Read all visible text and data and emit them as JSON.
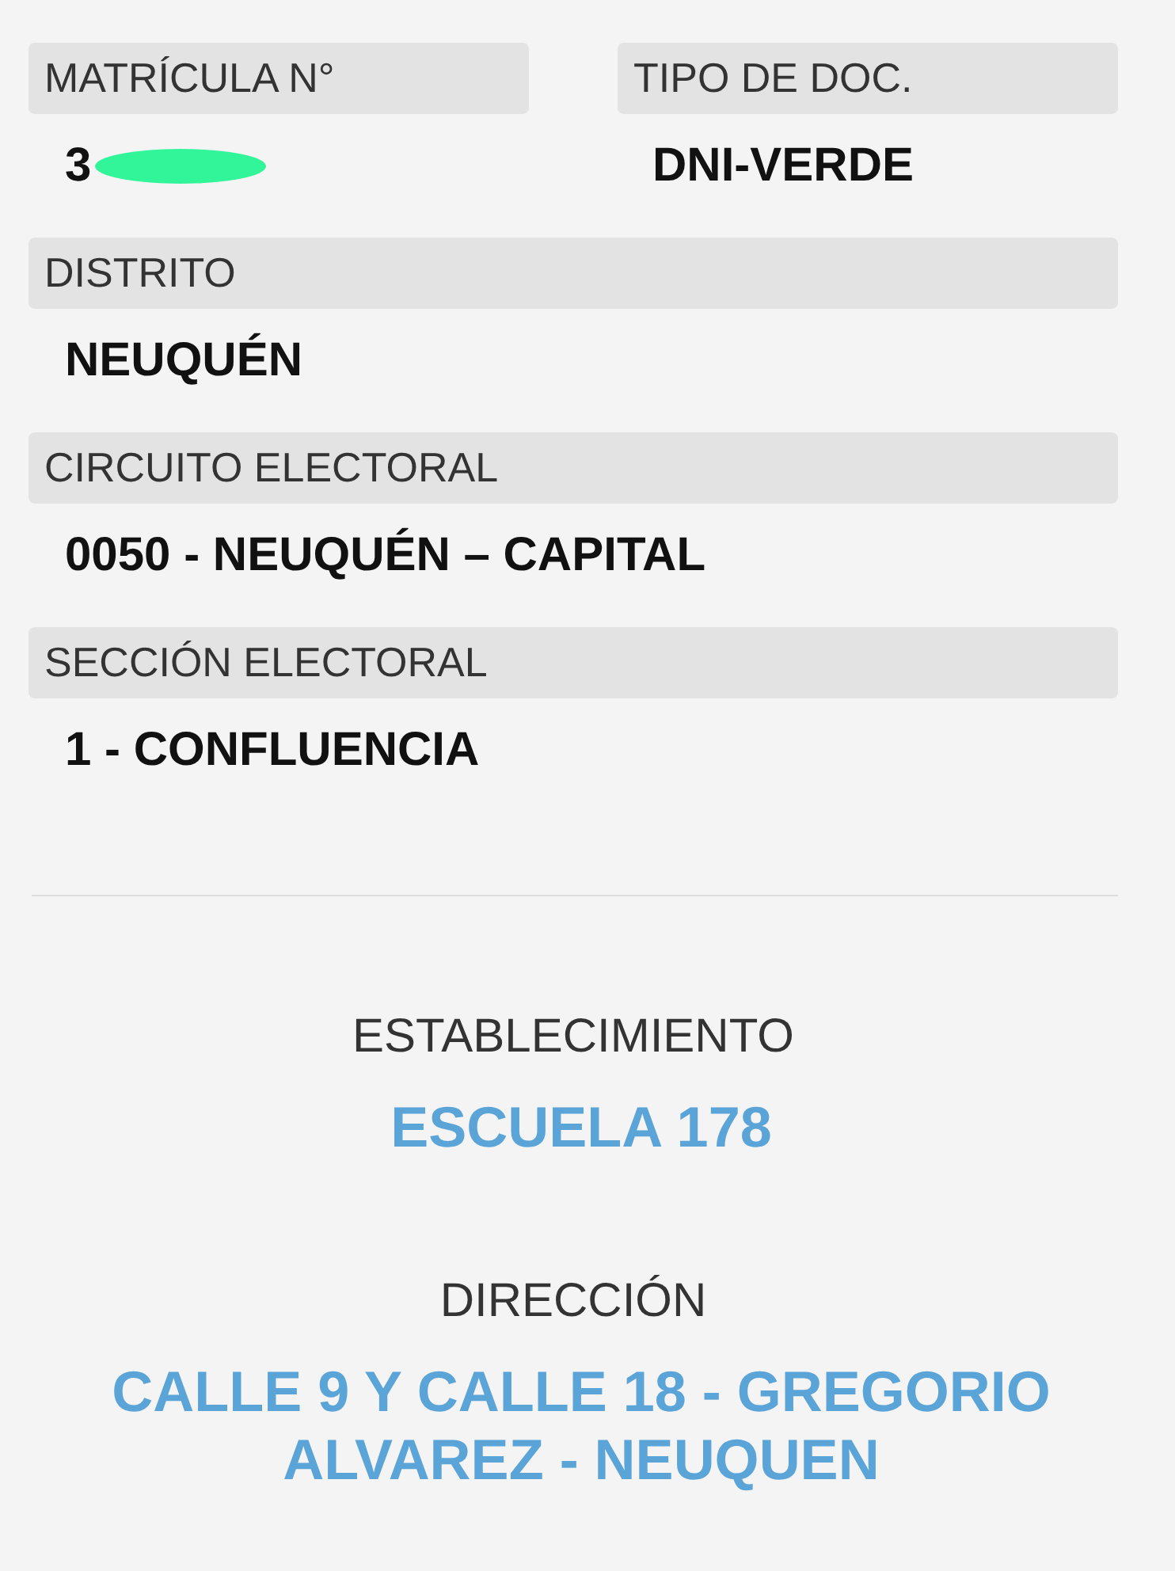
{
  "top_fields": [
    {
      "label": "MATRÍCULA N°",
      "value": "3",
      "redacted": true
    },
    {
      "label": "TIPO DE DOC.",
      "value": "DNI-VERDE"
    }
  ],
  "fields": [
    {
      "label": "DISTRITO",
      "value": "NEUQUÉN"
    },
    {
      "label": "CIRCUITO ELECTORAL",
      "value": "0050 - NEUQUÉN – CAPITAL"
    },
    {
      "label": "SECCIÓN ELECTORAL",
      "value": "1 - CONFLUENCIA"
    }
  ],
  "place": [
    {
      "label": "ESTABLECIMIENTO",
      "value": "ESCUELA 178"
    },
    {
      "label": "DIRECCIÓN",
      "value": "CALLE 9 Y CALLE 18 - GREGORIO ALVAREZ - NEUQUEN"
    }
  ]
}
